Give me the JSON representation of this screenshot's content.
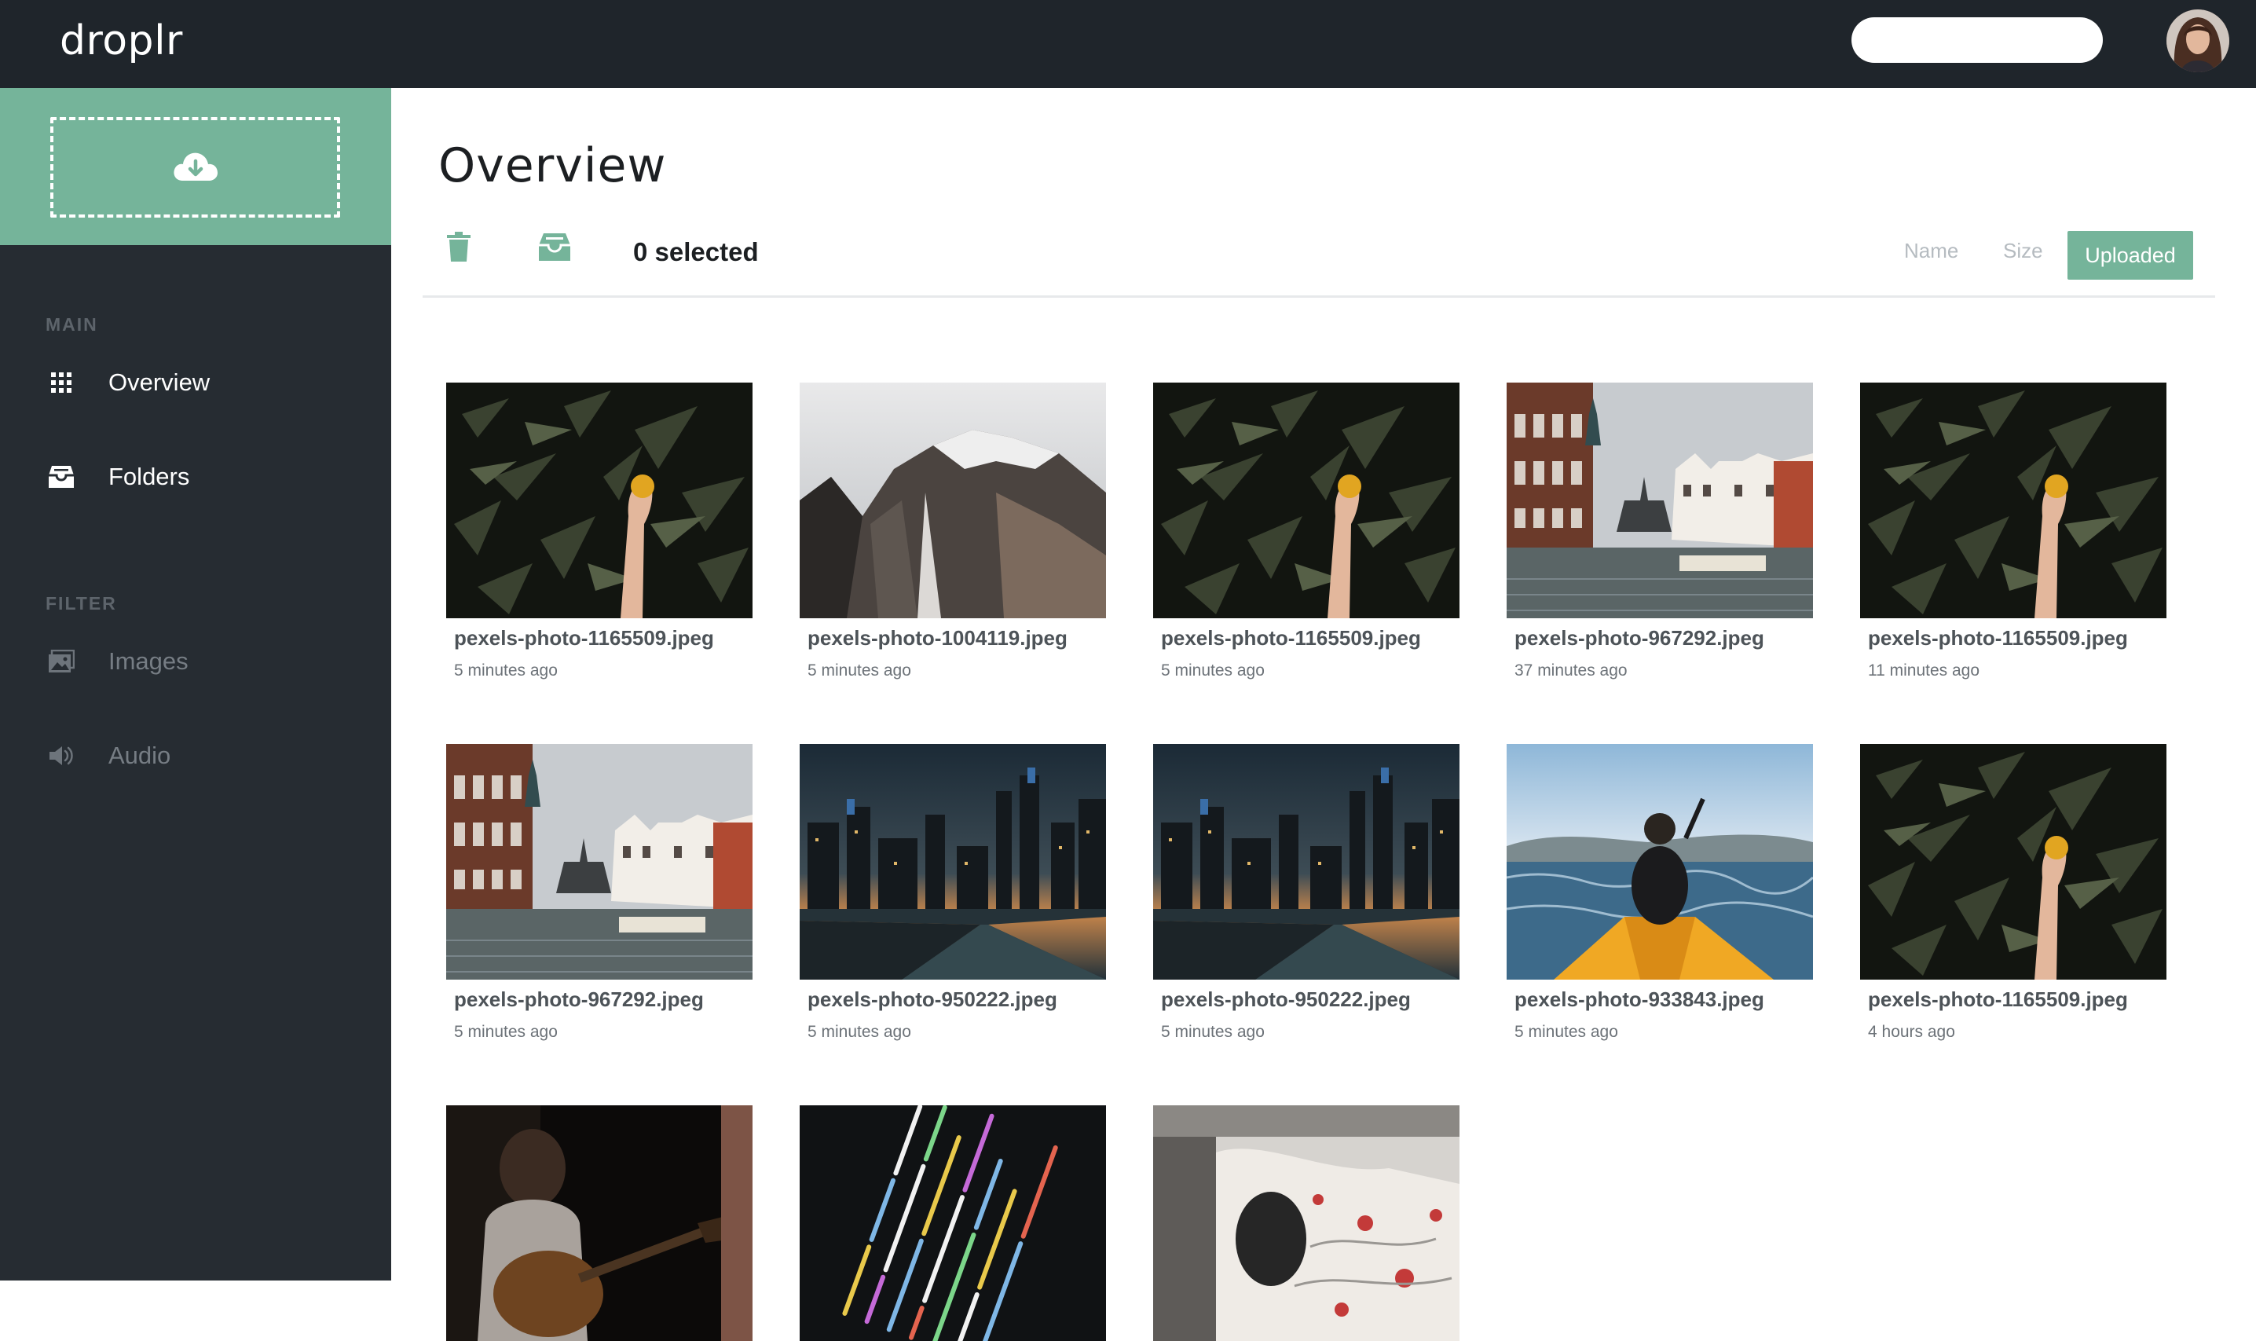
{
  "app": {
    "logo": "droplr",
    "search_placeholder": "",
    "accent_color": "#75b49a",
    "topbar_color": "#1f252b",
    "sidebar_color": "#262c32"
  },
  "sidebar": {
    "upload_icon": "cloud-download-icon",
    "main_label": "MAIN",
    "filter_label": "FILTER",
    "main_items": [
      {
        "label": "Overview",
        "icon": "grid-icon"
      },
      {
        "label": "Folders",
        "icon": "inbox-icon"
      }
    ],
    "filter_items": [
      {
        "label": "Images",
        "icon": "image-icon"
      },
      {
        "label": "Audio",
        "icon": "speaker-icon"
      }
    ]
  },
  "main": {
    "title": "Overview",
    "toolbar": {
      "delete_icon": "trash-icon",
      "archive_icon": "inbox-icon",
      "selected_text": "0 selected"
    },
    "sort": {
      "options": [
        "Name",
        "Size"
      ],
      "active": "Uploaded"
    },
    "files": [
      {
        "name": "pexels-photo-1165509.jpeg",
        "time": "5 minutes ago",
        "image": "plant-hand"
      },
      {
        "name": "pexels-photo-1004119.jpeg",
        "time": "5 minutes ago",
        "image": "mountain"
      },
      {
        "name": "pexels-photo-1165509.jpeg",
        "time": "5 minutes ago",
        "image": "plant-hand"
      },
      {
        "name": "pexels-photo-967292.jpeg",
        "time": "37 minutes ago",
        "image": "canal-city"
      },
      {
        "name": "pexels-photo-1165509.jpeg",
        "time": "11 minutes ago",
        "image": "plant-hand"
      },
      {
        "name": "pexels-photo-967292.jpeg",
        "time": "5 minutes ago",
        "image": "canal-city"
      },
      {
        "name": "pexels-photo-950222.jpeg",
        "time": "5 minutes ago",
        "image": "city-dusk"
      },
      {
        "name": "pexels-photo-950222.jpeg",
        "time": "5 minutes ago",
        "image": "city-dusk"
      },
      {
        "name": "pexels-photo-933843.jpeg",
        "time": "5 minutes ago",
        "image": "kayak"
      },
      {
        "name": "pexels-photo-1165509.jpeg",
        "time": "4 hours ago",
        "image": "plant-hand"
      },
      {
        "name": "",
        "time": "",
        "image": "guitarist"
      },
      {
        "name": "",
        "time": "",
        "image": "code-screen"
      },
      {
        "name": "",
        "time": "",
        "image": "bed-sheets"
      }
    ]
  }
}
